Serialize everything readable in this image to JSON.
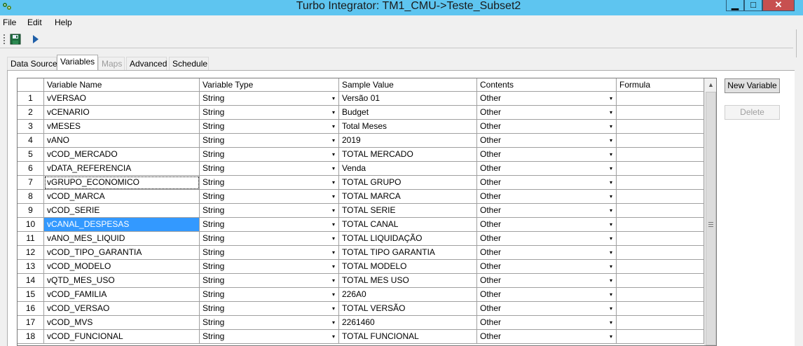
{
  "window": {
    "title": "Turbo Integrator:  TM1_CMU->Teste_Subset2",
    "controls": {
      "minimize": "▁",
      "maximize": "□",
      "close": "✕"
    }
  },
  "menu": {
    "file": "File",
    "edit": "Edit",
    "help": "Help"
  },
  "toolbar": {
    "save_icon": "floppy-disk-icon",
    "run_icon": "run-arrow-icon"
  },
  "tabs": [
    {
      "label": "Data Source",
      "state": "normal"
    },
    {
      "label": "Variables",
      "state": "active"
    },
    {
      "label": "Maps",
      "state": "disabled"
    },
    {
      "label": "Advanced",
      "state": "normal"
    },
    {
      "label": "Schedule",
      "state": "normal"
    }
  ],
  "grid": {
    "columns": [
      "Variable Name",
      "Variable Type",
      "Sample Value",
      "Contents",
      "Formula"
    ],
    "selected_row": 10,
    "focused_row": 7,
    "rows": [
      {
        "num": "1",
        "name": "vVERSAO",
        "type": "String",
        "sample": "Versão 01",
        "contents": "Other",
        "formula": ""
      },
      {
        "num": "2",
        "name": "vCENARIO",
        "type": "String",
        "sample": "Budget",
        "contents": "Other",
        "formula": ""
      },
      {
        "num": "3",
        "name": "vMESES",
        "type": "String",
        "sample": "Total Meses",
        "contents": "Other",
        "formula": ""
      },
      {
        "num": "4",
        "name": "vANO",
        "type": "String",
        "sample": "2019",
        "contents": "Other",
        "formula": ""
      },
      {
        "num": "5",
        "name": "vCOD_MERCADO",
        "type": "String",
        "sample": "TOTAL MERCADO",
        "contents": "Other",
        "formula": ""
      },
      {
        "num": "6",
        "name": "vDATA_REFERENCIA",
        "type": "String",
        "sample": "Venda",
        "contents": "Other",
        "formula": ""
      },
      {
        "num": "7",
        "name": "vGRUPO_ECONOMICO",
        "type": "String",
        "sample": "TOTAL GRUPO",
        "contents": "Other",
        "formula": ""
      },
      {
        "num": "8",
        "name": "vCOD_MARCA",
        "type": "String",
        "sample": "TOTAL MARCA",
        "contents": "Other",
        "formula": ""
      },
      {
        "num": "9",
        "name": "vCOD_SERIE",
        "type": "String",
        "sample": "TOTAL SERIE",
        "contents": "Other",
        "formula": ""
      },
      {
        "num": "10",
        "name": "vCANAL_DESPESAS",
        "type": "String",
        "sample": "TOTAL CANAL",
        "contents": "Other",
        "formula": ""
      },
      {
        "num": "11",
        "name": "vANO_MES_LIQUID",
        "type": "String",
        "sample": "TOTAL LIQUIDAÇÃO",
        "contents": "Other",
        "formula": ""
      },
      {
        "num": "12",
        "name": "vCOD_TIPO_GARANTIA",
        "type": "String",
        "sample": "TOTAL TIPO GARANTIA",
        "contents": "Other",
        "formula": ""
      },
      {
        "num": "13",
        "name": "vCOD_MODELO",
        "type": "String",
        "sample": "TOTAL MODELO",
        "contents": "Other",
        "formula": ""
      },
      {
        "num": "14",
        "name": "vQTD_MES_USO",
        "type": "String",
        "sample": "TOTAL MES USO",
        "contents": "Other",
        "formula": ""
      },
      {
        "num": "15",
        "name": "vCOD_FAMILIA",
        "type": "String",
        "sample": "226A0",
        "contents": "Other",
        "formula": ""
      },
      {
        "num": "16",
        "name": "vCOD_VERSAO",
        "type": "String",
        "sample": "TOTAL VERSÃO",
        "contents": "Other",
        "formula": ""
      },
      {
        "num": "17",
        "name": "vCOD_MVS",
        "type": "String",
        "sample": "2261460",
        "contents": "Other",
        "formula": ""
      },
      {
        "num": "18",
        "name": "vCOD_FUNCIONAL",
        "type": "String",
        "sample": "TOTAL FUNCIONAL",
        "contents": "Other",
        "formula": ""
      }
    ]
  },
  "buttons": {
    "new_variable": "New Variable",
    "delete": "Delete"
  },
  "colors": {
    "titlebar": "#5ec5f0",
    "selection": "#3399ff",
    "close_button": "#c75050"
  }
}
